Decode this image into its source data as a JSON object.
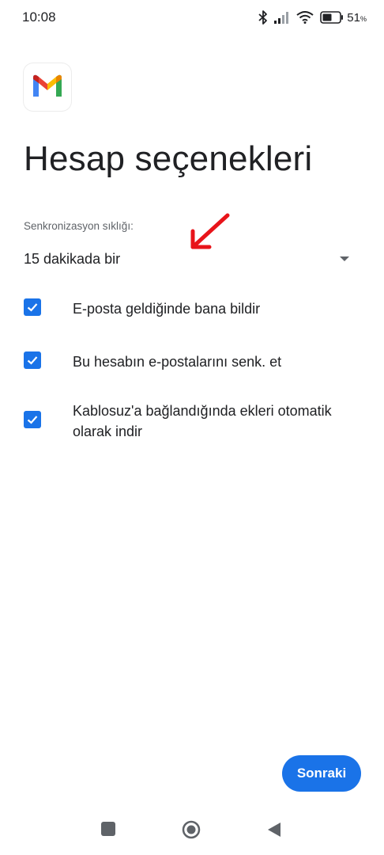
{
  "status_bar": {
    "time": "10:08",
    "battery_percent": "51",
    "battery_unit": "%",
    "icons": [
      "bluetooth-icon",
      "signal-icon",
      "wifi-icon",
      "battery-icon"
    ]
  },
  "app": {
    "logo": "gmail-logo-icon"
  },
  "page": {
    "title": "Hesap seçenekleri"
  },
  "sync": {
    "label": "Senkronizasyon sıklığı:",
    "value": "15 dakikada bir"
  },
  "options": [
    {
      "label": "E-posta geldiğinde bana bildir",
      "checked": true
    },
    {
      "label": "Bu hesabın e-postalarını senk. et",
      "checked": true
    },
    {
      "label": "Kablosuz'a bağlandığında ekleri otomatik olarak indir",
      "checked": true
    }
  ],
  "actions": {
    "next_label": "Sonraki"
  },
  "colors": {
    "accent": "#1a73e8",
    "annotation_arrow": "#e8141a"
  },
  "nav": [
    "recents-icon",
    "home-icon",
    "back-icon"
  ]
}
